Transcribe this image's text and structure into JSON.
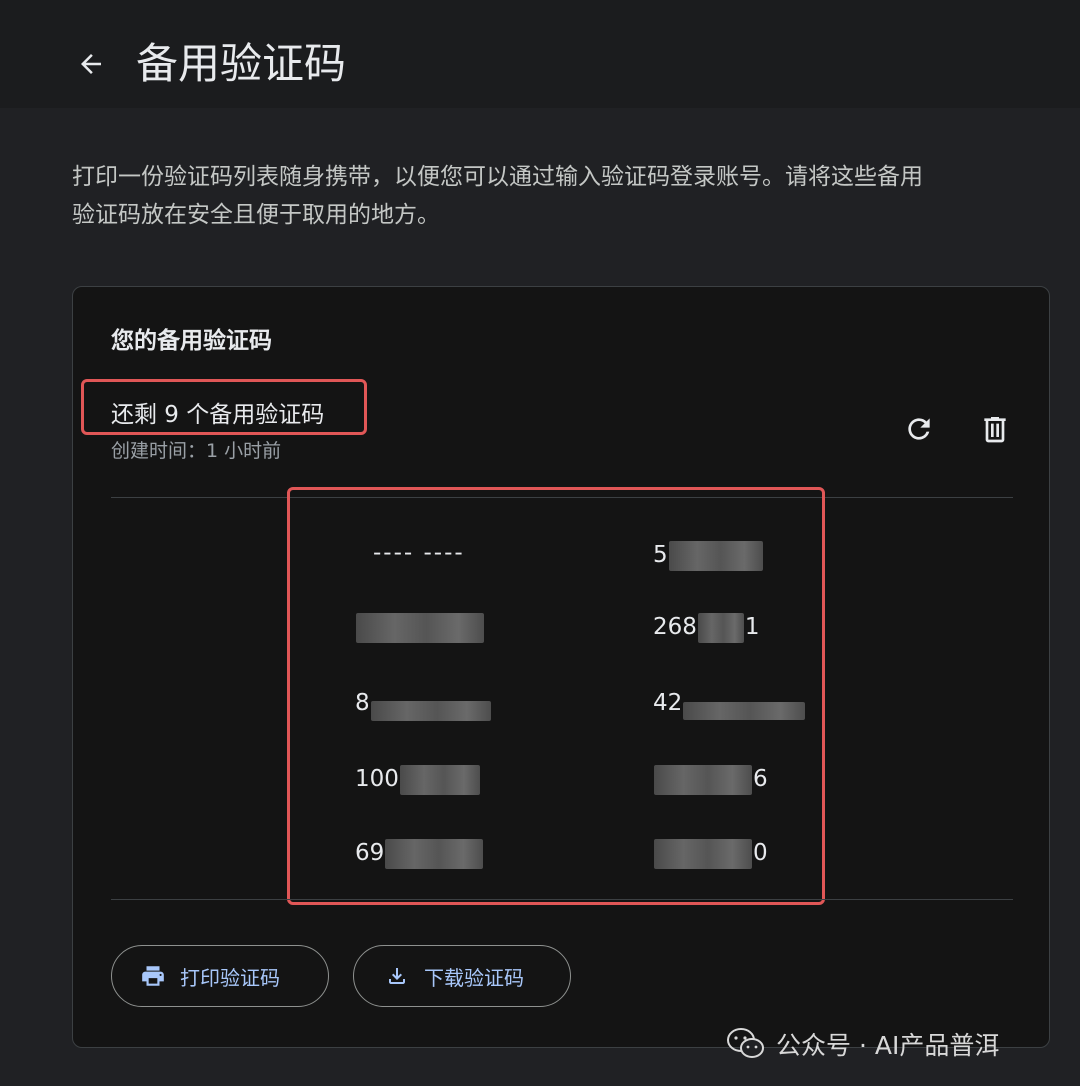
{
  "header": {
    "title": "备用验证码"
  },
  "description": "打印一份验证码列表随身携带，以便您可以通过输入验证码登录账号。请将这些备用验证码放在安全且便于取用的地方。",
  "card": {
    "title": "您的备用验证码",
    "remaining": "还剩 9 个备用验证码",
    "created": "创建时间：1 小时前",
    "codes": [
      {
        "visible": "---- ----"
      },
      {
        "visible": "5"
      },
      {
        "visible": ""
      },
      {
        "visible": "268",
        "suffix": "1"
      },
      {
        "visible": "8"
      },
      {
        "visible": "42"
      },
      {
        "visible": "100"
      },
      {
        "visible": "",
        "suffix": "6"
      },
      {
        "visible": "69"
      },
      {
        "visible": "",
        "suffix": "0"
      }
    ],
    "print_label": "打印验证码",
    "download_label": "下载验证码"
  },
  "watermark": {
    "text": "公众号 · AI产品普洱"
  },
  "colors": {
    "accent": "#a8c7fa",
    "highlight": "#e05757",
    "background": "#202124"
  }
}
